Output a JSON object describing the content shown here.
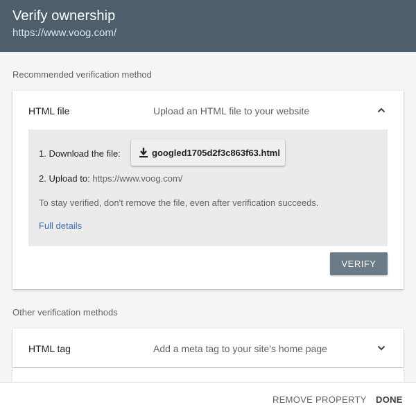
{
  "header": {
    "title": "Verify ownership",
    "subtitle": "https://www.voog.com/"
  },
  "recommended": {
    "section_label": "Recommended verification method",
    "method": "HTML file",
    "description": "Upload an HTML file to your website",
    "expanded": true,
    "steps": {
      "download_label": "1. Download the file:",
      "file_name": "googled1705d2f3c863f63.html",
      "upload_label": "2. Upload to:",
      "upload_url": "https://www.voog.com/"
    },
    "note": "To stay verified, don't remove the file, even after verification succeeds.",
    "details_link": "Full details",
    "verify_button": "VERIFY"
  },
  "other": {
    "section_label": "Other verification methods",
    "methods": [
      {
        "method": "HTML tag",
        "description": "Add a meta tag to your site's home page"
      }
    ]
  },
  "footer": {
    "remove_button": "REMOVE PROPERTY",
    "done_button": "DONE"
  },
  "icons": {
    "download": "download-icon",
    "collapse": "chevron-up-icon",
    "expand": "chevron-down-icon"
  },
  "colors": {
    "header_bg": "#4e5f6b",
    "verify_bg": "#6b7b87",
    "link": "#3b6fb6"
  }
}
